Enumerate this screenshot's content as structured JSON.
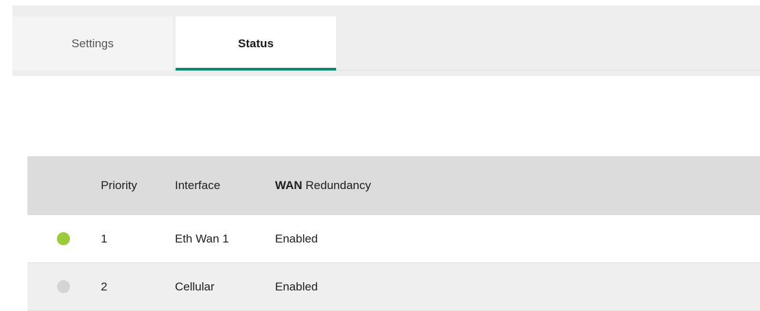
{
  "tabs": [
    {
      "label": "Settings",
      "active": false
    },
    {
      "label": "Status",
      "active": true
    }
  ],
  "colors": {
    "accent": "#0e8a73",
    "status_up": "#9bcb3a",
    "status_down": "#d4d4d4"
  },
  "table": {
    "headers": {
      "status": "",
      "priority": "Priority",
      "interface": "Interface",
      "wan_bold": "WAN",
      "wan_rest": " Redundancy"
    },
    "rows": [
      {
        "status": "up",
        "status_icon": "status-dot-green-icon",
        "priority": "1",
        "interface": "Eth Wan 1",
        "wan_redundancy": "Enabled"
      },
      {
        "status": "inactive",
        "status_icon": "status-dot-gray-icon",
        "priority": "2",
        "interface": "Cellular",
        "wan_redundancy": "Enabled"
      }
    ]
  }
}
